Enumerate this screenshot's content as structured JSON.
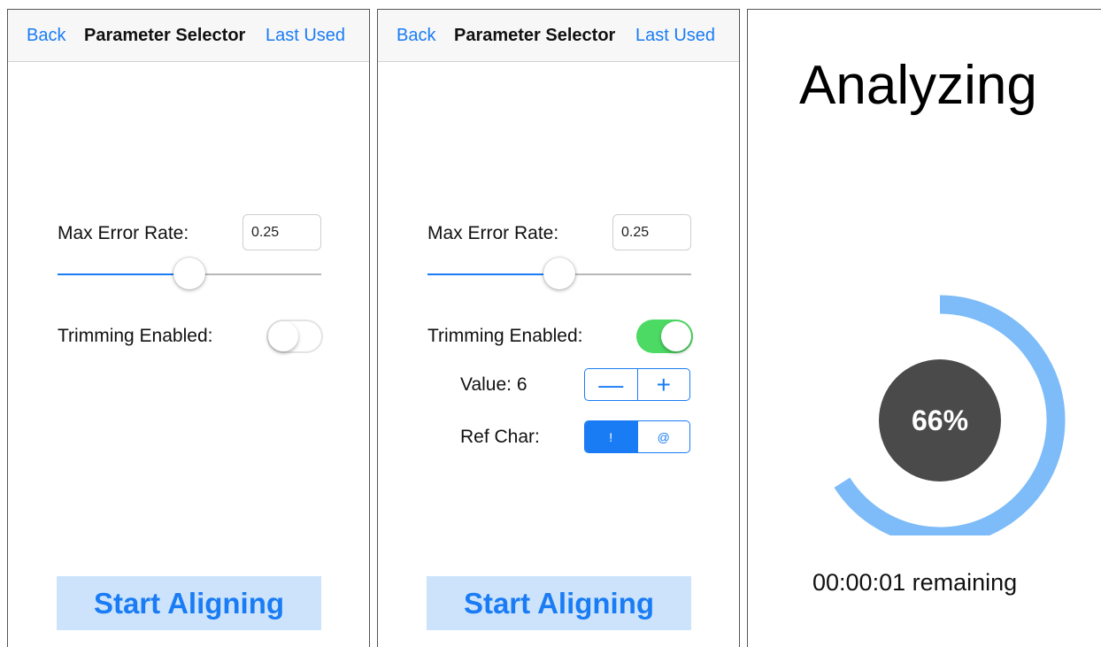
{
  "colors": {
    "accent": "#1a7cf5",
    "switch_on": "#4cd964",
    "button_bg": "#cce3fb",
    "progress_ring": "#7dbcf8",
    "progress_center": "#4a4a4a"
  },
  "screens": [
    {
      "nav": {
        "back_label": "Back",
        "title": "Parameter Selector",
        "right_label": "Last Used"
      },
      "max_error_label": "Max Error Rate:",
      "max_error_value": "0.25",
      "slider_fraction": 0.5,
      "trimming_label": "Trimming Enabled:",
      "trimming_enabled": false,
      "start_label": "Start Aligning"
    },
    {
      "nav": {
        "back_label": "Back",
        "title": "Parameter Selector",
        "right_label": "Last Used"
      },
      "max_error_label": "Max Error Rate:",
      "max_error_value": "0.25",
      "slider_fraction": 0.5,
      "trimming_label": "Trimming Enabled:",
      "trimming_enabled": true,
      "value_label": "Value: 6",
      "stepper": {
        "minus": "—",
        "plus": "+"
      },
      "ref_char_label": "Ref Char:",
      "ref_char_options": [
        "!",
        "@"
      ],
      "ref_char_selected": 0,
      "start_label": "Start Aligning"
    }
  ],
  "analyzing": {
    "title": "Analyzing",
    "progress_percent": 66,
    "progress_text": "66%",
    "remaining_text": "00:00:01 remaining"
  }
}
